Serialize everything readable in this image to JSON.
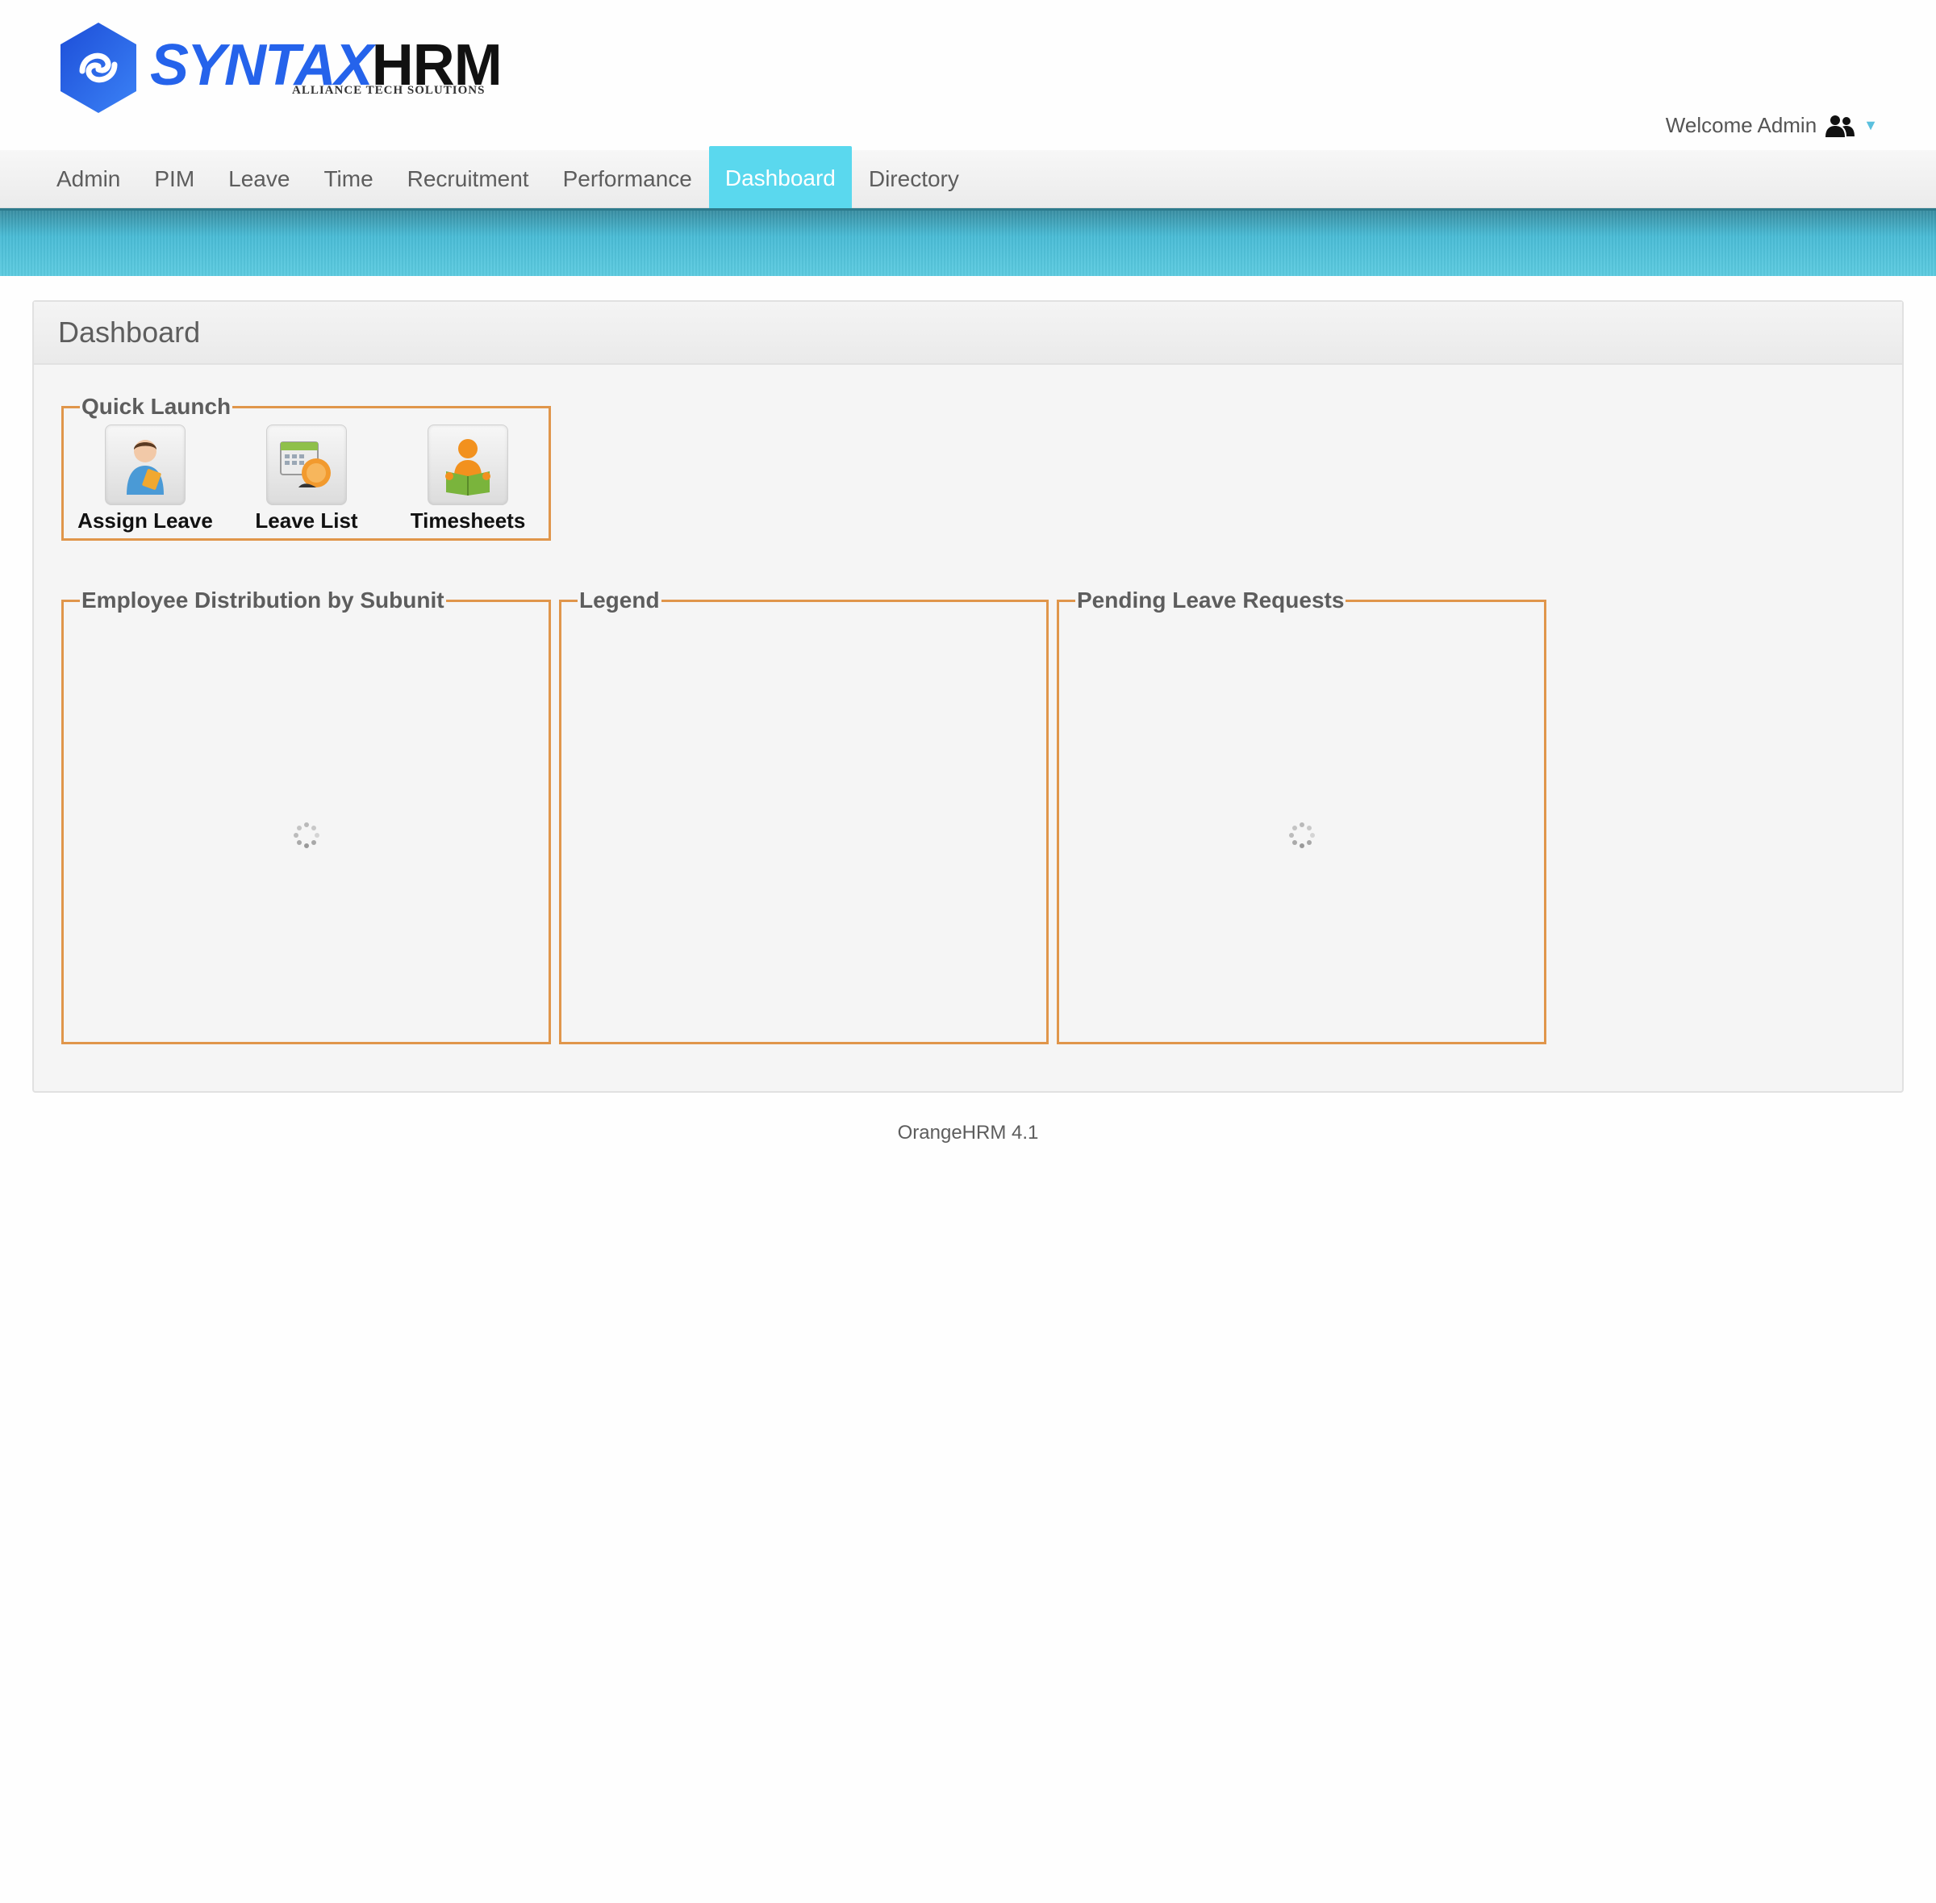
{
  "brand": {
    "logo_syntax": "SYNTAX",
    "logo_hrm": "HRM",
    "logo_subtitle": "ALLIANCE TECH SOLUTIONS",
    "accent_color": "#2563eb"
  },
  "welcome": {
    "text": "Welcome Admin",
    "icon": "users-icon"
  },
  "menu": {
    "items": [
      {
        "label": "Admin"
      },
      {
        "label": "PIM"
      },
      {
        "label": "Leave"
      },
      {
        "label": "Time"
      },
      {
        "label": "Recruitment"
      },
      {
        "label": "Performance"
      },
      {
        "label": "Dashboard",
        "active": true
      },
      {
        "label": "Directory"
      }
    ],
    "active_color": "#5ad8ee"
  },
  "panel": {
    "title": "Dashboard"
  },
  "quick_launch": {
    "title": "Quick Launch",
    "items": [
      {
        "label": "Assign Leave",
        "icon": "assign-leave-icon"
      },
      {
        "label": "Leave List",
        "icon": "leave-list-icon"
      },
      {
        "label": "Timesheets",
        "icon": "timesheets-icon"
      }
    ]
  },
  "widgets": {
    "distribution_title": "Employee Distribution by Subunit",
    "legend_title": "Legend",
    "pending_title": "Pending Leave Requests",
    "border_color": "#e0964b"
  },
  "footer": {
    "text": "OrangeHRM 4.1"
  }
}
